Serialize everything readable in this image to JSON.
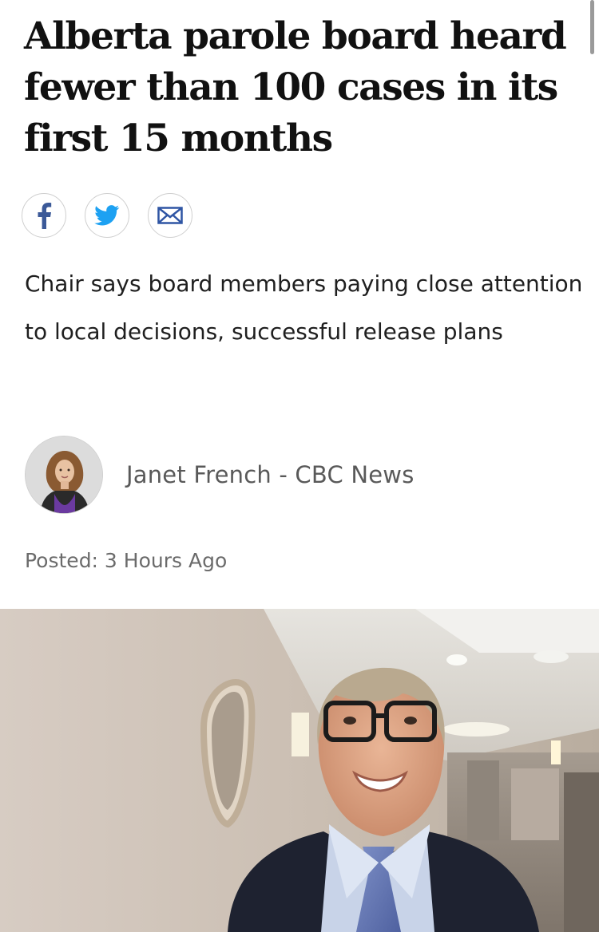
{
  "article": {
    "headline": "Alberta parole board heard fewer than 100 cases in its first 15 months",
    "deck": "Chair says board members paying close attention to local decisions, successful release plans",
    "byline": "Janet French - CBC News",
    "posted": "Posted: 3 Hours Ago"
  },
  "share": {
    "buttons": [
      {
        "icon": "facebook-icon",
        "color": "#3b5998"
      },
      {
        "icon": "twitter-icon",
        "color": "#1da1f2"
      },
      {
        "icon": "email-icon",
        "color": "#2f55a4"
      }
    ]
  }
}
